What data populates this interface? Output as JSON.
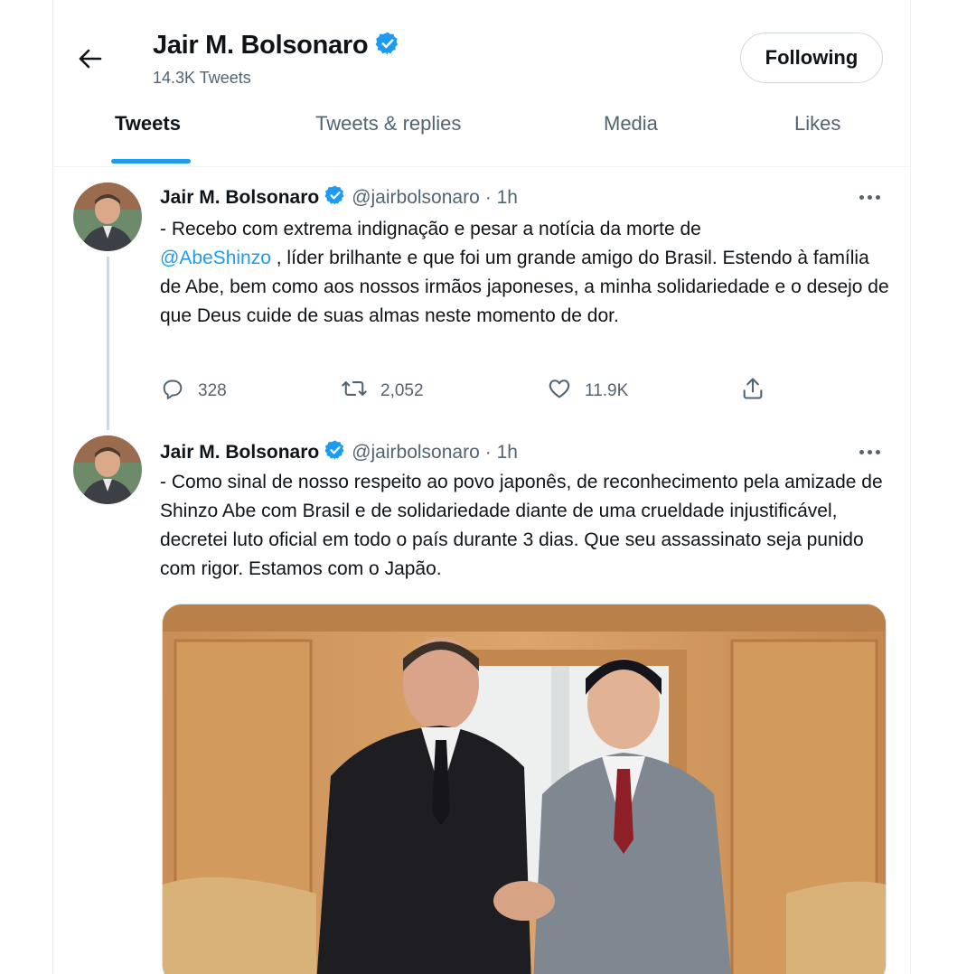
{
  "header": {
    "name": "Jair M. Bolsonaro",
    "tweet_count": "14.3K Tweets",
    "follow_label": "Following"
  },
  "tabs": [
    {
      "label": "Tweets"
    },
    {
      "label": "Tweets & replies"
    },
    {
      "label": "Media"
    },
    {
      "label": "Likes"
    }
  ],
  "tweets": [
    {
      "name": "Jair M. Bolsonaro",
      "handle": "@jairbolsonaro",
      "time": "· 1h",
      "text_before": "- Recebo com extrema indignação e pesar a notícia da morte de",
      "mention": "@AbeShinzo",
      "text_after": " , líder brilhante e que foi um grande amigo do Brasil. Estendo à família de Abe, bem como aos nossos irmãos japoneses, a minha solidariedade e o desejo de que Deus cuide de suas almas neste momento de dor.",
      "replies": "328",
      "retweets": "2,052",
      "likes": "11.9K"
    },
    {
      "name": "Jair M. Bolsonaro",
      "handle": "@jairbolsonaro",
      "time": "· 1h",
      "text": "- Como sinal de nosso respeito ao povo japonês, de reconhecimento pela amizade de Shinzo Abe com Brasil e de solidariedade diante de uma crueldade injustificável, decretei luto oficial em todo o país durante 3 dias. Que seu  assassinato seja punido com rigor. Estamos com o Japão."
    }
  ],
  "colors": {
    "accent": "#1d9bf0",
    "muted": "#536471",
    "text": "#0f1419"
  },
  "icons": [
    "back-arrow-icon",
    "verified-badge-icon",
    "more-icon",
    "reply-icon",
    "retweet-icon",
    "like-icon",
    "share-icon"
  ]
}
